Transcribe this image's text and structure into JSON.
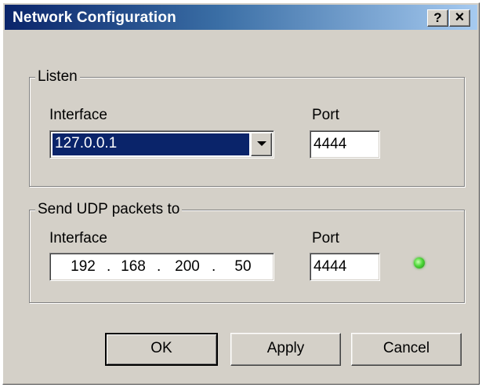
{
  "window": {
    "title": "Network Configuration",
    "help_button": "?",
    "close_button": "×"
  },
  "listen": {
    "group_label": "Listen",
    "interface_label": "Interface",
    "interface_value": "127.0.0.1",
    "port_label": "Port",
    "port_value": "4444"
  },
  "send": {
    "group_label": "Send UDP packets to",
    "interface_label": "Interface",
    "ip_octets": [
      "192",
      "168",
      "200",
      "50"
    ],
    "ip_separator": ".",
    "port_label": "Port",
    "port_value": "4444",
    "status_led_color": "#4fd83a"
  },
  "buttons": {
    "ok": "OK",
    "apply": "Apply",
    "cancel": "Cancel"
  },
  "colors": {
    "titlebar_start": "#0a246a",
    "titlebar_end": "#a6caf0",
    "face": "#d4d0c8",
    "selection": "#0a246a"
  },
  "icons": {
    "combo_arrow": "chevron-down-icon",
    "status_led": "status-led-icon"
  }
}
